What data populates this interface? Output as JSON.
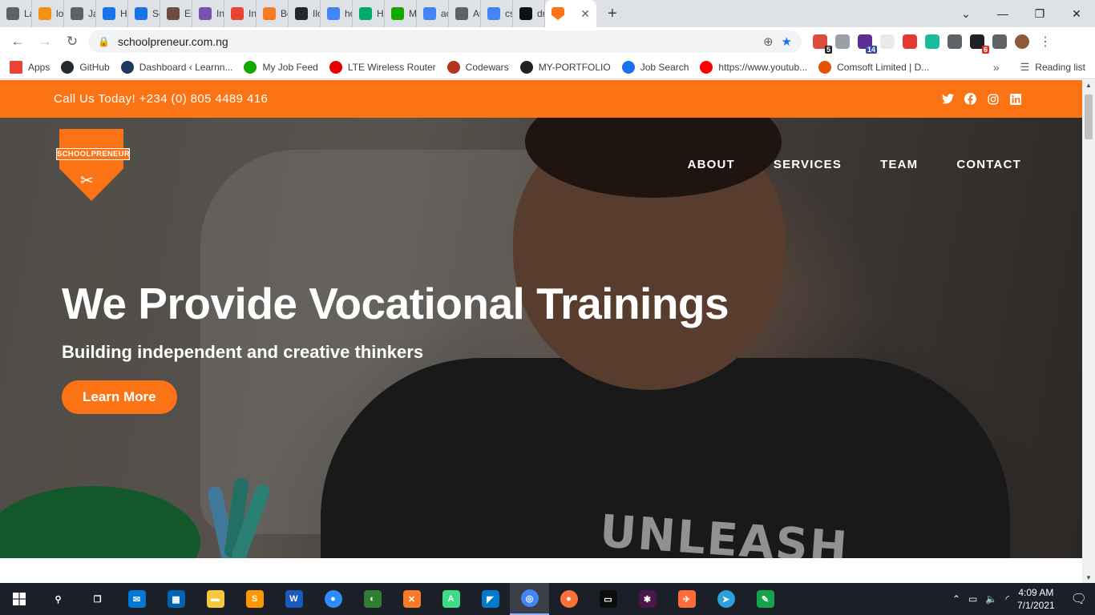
{
  "browser": {
    "tabs": [
      {
        "label": "Lara",
        "icon": "globe-icon",
        "color": "#5f6368"
      },
      {
        "label": "loca",
        "icon": "pma-icon",
        "color": "#f29111"
      },
      {
        "label": "Java",
        "icon": "globe-icon",
        "color": "#5f6368"
      },
      {
        "label": "Hist",
        "icon": "history-icon",
        "color": "#1a73e8"
      },
      {
        "label": "Setti",
        "icon": "settings-icon",
        "color": "#1a73e8"
      },
      {
        "label": "Eme",
        "icon": "avatar-icon",
        "color": "#6d4c41"
      },
      {
        "label": "Inpu",
        "icon": "bootstrap-icon",
        "color": "#7952b3"
      },
      {
        "label": "Inbc",
        "icon": "gmail-icon",
        "color": "#ea4335"
      },
      {
        "label": "Boo",
        "icon": "xampp-icon",
        "color": "#fb7a24"
      },
      {
        "label": "Ilob",
        "icon": "github-icon",
        "color": "#24292e"
      },
      {
        "label": "how",
        "icon": "google-icon",
        "color": "#4285f4"
      },
      {
        "label": "How",
        "icon": "w3-icon",
        "color": "#04aa6d"
      },
      {
        "label": "My",
        "icon": "upwork-icon",
        "color": "#14a800"
      },
      {
        "label": "aos",
        "icon": "google-icon",
        "color": "#4285f4"
      },
      {
        "label": "AOS",
        "icon": "globe-icon",
        "color": "#5f6368"
      },
      {
        "label": "css f",
        "icon": "google-icon",
        "color": "#4285f4"
      },
      {
        "label": "drop",
        "icon": "codepen-icon",
        "color": "#111111"
      }
    ],
    "active_tab": {
      "icon": "schoolpreneur-favicon-icon",
      "color": "#fb7315"
    },
    "new_tab": "+",
    "url": "schoolpreneur.com.ng",
    "extensions": [
      {
        "name": "todoist-extension-icon",
        "color": "#db4c3f",
        "badge": "5",
        "badge_color": "#202124"
      },
      {
        "name": "vue-extension-icon",
        "color": "#9aa0a6",
        "badge": "",
        "badge_color": ""
      },
      {
        "name": "school-extension-icon",
        "color": "#5c2d91",
        "badge": "14",
        "badge_color": "#3949ab"
      },
      {
        "name": "blank-extension-icon",
        "color": "#e8eaed",
        "badge": "",
        "badge_color": ""
      },
      {
        "name": "adblock-extension-icon",
        "color": "#e53935",
        "badge": "",
        "badge_color": ""
      },
      {
        "name": "m-extension-icon",
        "color": "#1abc9c",
        "badge": "",
        "badge_color": ""
      },
      {
        "name": "coins-extension-icon",
        "color": "#5f6368",
        "badge": "",
        "badge_color": ""
      },
      {
        "name": "tasks-extension-icon",
        "color": "#202124",
        "badge": "6",
        "badge_color": "#d93025"
      },
      {
        "name": "puzzle-extension-icon",
        "color": "#5f6368",
        "badge": "",
        "badge_color": ""
      },
      {
        "name": "profile-avatar-icon",
        "color": "#8d5a3b",
        "badge": "",
        "badge_color": ""
      }
    ]
  },
  "bookmarks": {
    "items": [
      {
        "label": "Apps",
        "icon": "apps-grid-icon",
        "color": "#ea4335"
      },
      {
        "label": "GitHub",
        "icon": "github-icon",
        "color": "#24292e"
      },
      {
        "label": "Dashboard ‹ Learnn...",
        "icon": "learnn-icon",
        "color": "#1e3a5f"
      },
      {
        "label": "My Job Feed",
        "icon": "upwork-icon",
        "color": "#14a800"
      },
      {
        "label": "LTE Wireless Router",
        "icon": "airtel-icon",
        "color": "#e40000"
      },
      {
        "label": "Codewars",
        "icon": "codewars-icon",
        "color": "#b1361e"
      },
      {
        "label": "MY-PORTFOLIO",
        "icon": "portfolio-icon",
        "color": "#222222"
      },
      {
        "label": "Job Search",
        "icon": "job-search-icon",
        "color": "#1a73e8"
      },
      {
        "label": "https://www.youtub...",
        "icon": "youtube-icon",
        "color": "#ff0000"
      },
      {
        "label": "Comsoft Limited | D...",
        "icon": "comsoft-icon",
        "color": "#e65100"
      }
    ],
    "more": "»",
    "reading_list": "Reading list"
  },
  "site": {
    "phone": "Call Us Today! +234 (0) 805 4489 416",
    "socials": [
      "twitter-icon",
      "facebook-icon",
      "instagram-icon",
      "linkedin-icon"
    ],
    "logo_text": "SCHOOLPRENEUR",
    "nav": [
      "ABOUT",
      "SERVICES",
      "TEAM",
      "CONTACT"
    ],
    "hero_title": "We Provide Vocational Trainings",
    "hero_subtitle": "Building independent and creative thinkers",
    "cta": "Learn More",
    "shirt_text": "UNLEASH",
    "accent_color": "#fb7315"
  },
  "taskbar": {
    "apps": [
      {
        "name": "search-icon",
        "color": "#1b1f27",
        "glyph": "⚲"
      },
      {
        "name": "task-view-icon",
        "color": "#1b1f27",
        "glyph": "❐"
      },
      {
        "name": "mail-app-icon",
        "color": "#0078d4",
        "glyph": "✉"
      },
      {
        "name": "store-app-icon",
        "color": "#0063b1",
        "glyph": "▦"
      },
      {
        "name": "file-explorer-icon",
        "color": "#f8c73e",
        "glyph": "▬"
      },
      {
        "name": "sublime-text-icon",
        "color": "#ff9800",
        "glyph": "S"
      },
      {
        "name": "word-app-icon",
        "color": "#185abd",
        "glyph": "W"
      },
      {
        "name": "zoom-app-icon",
        "color": "#2d8cff",
        "glyph": "●"
      },
      {
        "name": "inkscape-icon",
        "color": "#2e7d32",
        "glyph": "◐"
      },
      {
        "name": "xampp-icon",
        "color": "#fb7a24",
        "glyph": "✕"
      },
      {
        "name": "android-studio-icon",
        "color": "#3ddc84",
        "glyph": "A"
      },
      {
        "name": "vscode-icon",
        "color": "#007acc",
        "glyph": "◤"
      },
      {
        "name": "chrome-icon",
        "color": "#4285f4",
        "glyph": "◎"
      },
      {
        "name": "firefox-icon",
        "color": "#ff7139",
        "glyph": "●"
      },
      {
        "name": "terminal-icon",
        "color": "#0c0c0c",
        "glyph": "▭"
      },
      {
        "name": "slack-icon",
        "color": "#4a154b",
        "glyph": "✱"
      },
      {
        "name": "postman-icon",
        "color": "#ff6c37",
        "glyph": "✈"
      },
      {
        "name": "telegram-icon",
        "color": "#2aa1da",
        "glyph": "➤"
      },
      {
        "name": "notepad-icon",
        "color": "#16a34a",
        "glyph": "✎"
      }
    ],
    "time": "4:09 AM",
    "date": "7/1/2021"
  }
}
